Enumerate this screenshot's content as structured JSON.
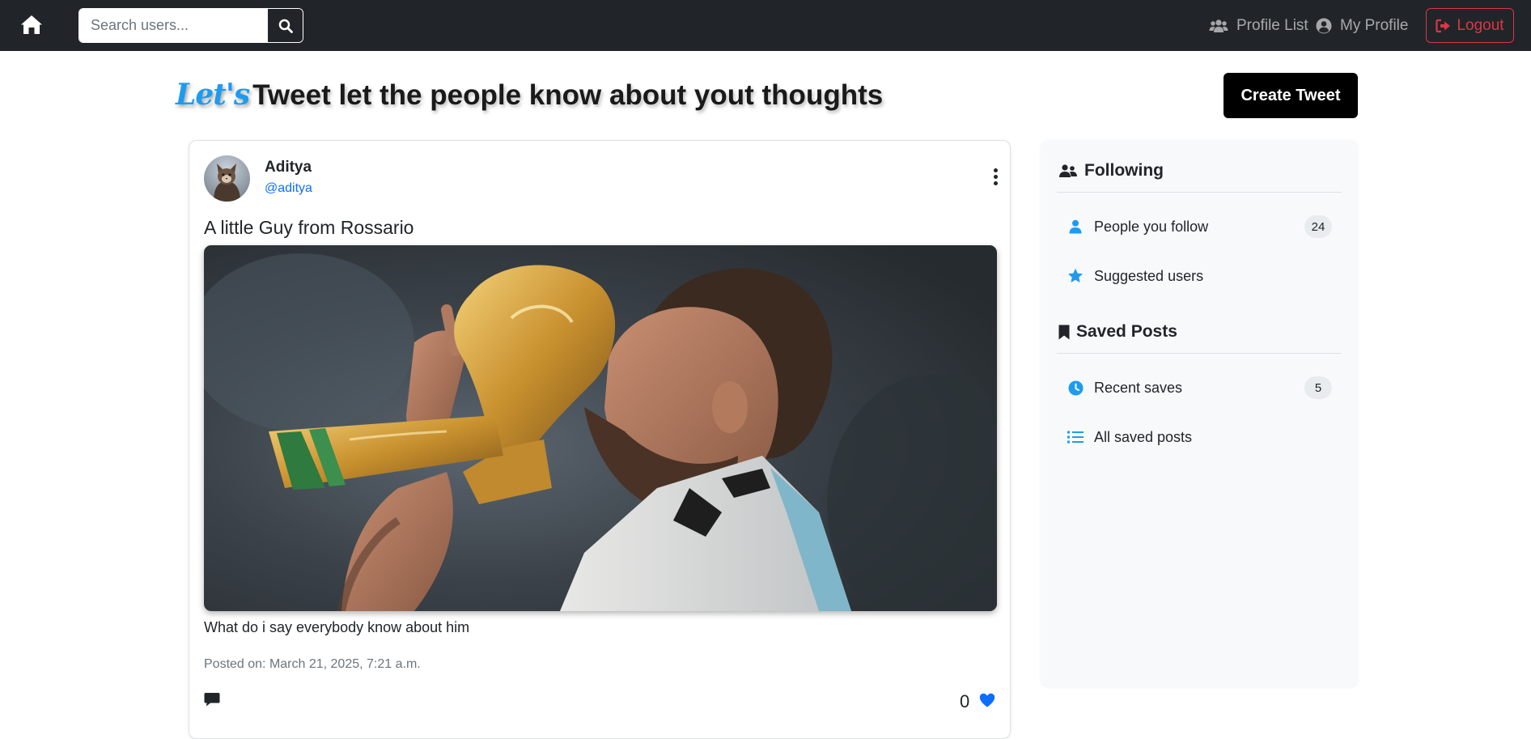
{
  "navbar": {
    "search_placeholder": "Search users...",
    "profile_list_label": "Profile List",
    "my_profile_label": "My Profile",
    "logout_label": "Logout"
  },
  "header": {
    "accent": "Let's",
    "title": "Tweet let the people know about yout thoughts",
    "create_label": "Create Tweet"
  },
  "post": {
    "author_name": "Aditya",
    "author_handle": "@aditya",
    "title": "A little Guy from Rossario",
    "body": "What do i say everybody know about him",
    "posted_on": "Posted on: March 21, 2025, 7:21 a.m.",
    "likes": "0"
  },
  "sidebar": {
    "following_title": "Following",
    "following_items": [
      {
        "label": "People you follow",
        "badge": "24",
        "icon": "user-icon"
      },
      {
        "label": "Suggested users",
        "icon": "star-icon"
      }
    ],
    "saved_title": "Saved Posts",
    "saved_items": [
      {
        "label": "Recent saves",
        "badge": "5",
        "icon": "clock-icon"
      },
      {
        "label": "All saved posts",
        "icon": "list-icon"
      }
    ]
  },
  "colors": {
    "navbar_bg": "#212529",
    "accent_blue": "#1d9bf0",
    "logout_red": "#dc3545",
    "link_blue": "#0d6efd"
  }
}
